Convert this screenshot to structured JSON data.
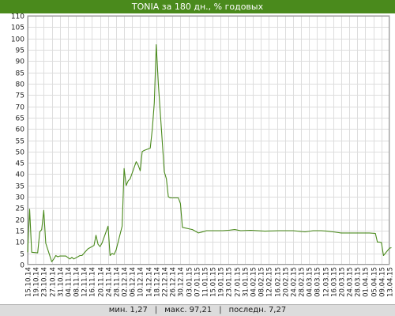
{
  "chart_data": {
    "type": "line",
    "title": "TONIA за 180 дн., % годовых",
    "ylim": [
      0,
      110
    ],
    "yticks": [
      0,
      5,
      10,
      15,
      20,
      25,
      30,
      35,
      40,
      45,
      50,
      55,
      60,
      65,
      70,
      75,
      80,
      85,
      90,
      95,
      100,
      105,
      110
    ],
    "grid": true,
    "legend": "none",
    "line_color": "#4a8a1c",
    "x_tick_labels": [
      "15.10.14",
      "19.10.14",
      "23.10.14",
      "27.10.14",
      "31.10.14",
      "04.11.14",
      "08.11.14",
      "12.11.14",
      "16.11.14",
      "20.11.14",
      "24.11.14",
      "28.11.14",
      "02.12.14",
      "06.12.14",
      "10.12.14",
      "14.12.14",
      "18.12.14",
      "22.12.14",
      "26.12.14",
      "30.12.14",
      "03.01.15",
      "07.01.15",
      "11.01.15",
      "15.01.15",
      "19.01.15",
      "23.01.15",
      "27.01.15",
      "31.01.15",
      "04.02.15",
      "08.02.15",
      "12.02.15",
      "16.02.15",
      "20.02.15",
      "24.02.15",
      "28.02.15",
      "04.03.15",
      "08.03.15",
      "12.03.15",
      "16.03.15",
      "20.03.15",
      "24.03.15",
      "28.03.15",
      "01.04.15",
      "05.04.15",
      "09.04.15",
      "13.04.15"
    ],
    "series": [
      {
        "x": [
          "15.10.14",
          "16.10.14",
          "17.10.14",
          "20.10.14",
          "21.10.14",
          "22.10.14",
          "23.10.14",
          "24.10.14",
          "27.10.14",
          "28.10.14",
          "29.10.14",
          "30.10.14",
          "31.10.14",
          "03.11.14",
          "05.11.14",
          "06.11.14",
          "07.11.14",
          "10.11.14",
          "11.11.14",
          "12.11.14",
          "13.11.14",
          "14.11.14",
          "17.11.14",
          "18.11.14",
          "19.11.14",
          "20.11.14",
          "21.11.14",
          "24.11.14",
          "25.11.14",
          "26.11.14",
          "27.11.14",
          "28.11.14",
          "01.12.14",
          "02.12.14",
          "03.12.14",
          "04.12.14",
          "05.12.14",
          "08.12.14",
          "09.12.14",
          "10.12.14",
          "11.12.14",
          "12.12.14",
          "15.12.14",
          "16.12.14",
          "17.12.14",
          "18.12.14",
          "19.12.14",
          "22.12.14",
          "23.12.14",
          "24.12.14",
          "25.12.14",
          "26.12.14",
          "29.12.14",
          "30.12.14",
          "31.12.14",
          "05.01.15",
          "08.01.15",
          "12.01.15",
          "16.01.15",
          "20.01.15",
          "23.01.15",
          "26.01.15",
          "29.01.15",
          "03.02.15",
          "10.02.15",
          "17.02.15",
          "24.02.15",
          "02.03.15",
          "06.03.15",
          "10.03.15",
          "13.03.15",
          "16.03.15",
          "20.03.15",
          "24.03.15",
          "27.03.15",
          "30.03.15",
          "01.04.15",
          "03.04.15",
          "06.04.15",
          "07.04.15",
          "08.04.15",
          "09.04.15",
          "10.04.15",
          "13.04.15",
          "14.04.15"
        ],
        "values": [
          5.5,
          24.5,
          5.5,
          5.2,
          14.5,
          15.5,
          24,
          9.5,
          1.3,
          2.5,
          4,
          3.5,
          3.8,
          3.8,
          2.5,
          3.2,
          2.5,
          4,
          4,
          5,
          6,
          7,
          8.5,
          13,
          9,
          8,
          9.5,
          17,
          4,
          5,
          4.5,
          6.5,
          17,
          42.5,
          35,
          37,
          38,
          45.5,
          44,
          41.5,
          50,
          50.5,
          51.5,
          60,
          71.5,
          97.21,
          80,
          41,
          38,
          30,
          29.5,
          29.5,
          29.5,
          27,
          16.5,
          15.5,
          14,
          15,
          15,
          15,
          15.2,
          15.5,
          15,
          15.2,
          14.8,
          15,
          15,
          14.5,
          15,
          15,
          14.8,
          14.5,
          14,
          14,
          14,
          14,
          14,
          14,
          13.8,
          10,
          10,
          9.8,
          4,
          7.27,
          7.5
        ]
      }
    ],
    "footer": {
      "min_label": "мин.",
      "min_value": "1,27",
      "max_label": "макс.",
      "max_value": "97,21",
      "last_label": "последн.",
      "last_value": "7,27",
      "separator": "|"
    }
  }
}
